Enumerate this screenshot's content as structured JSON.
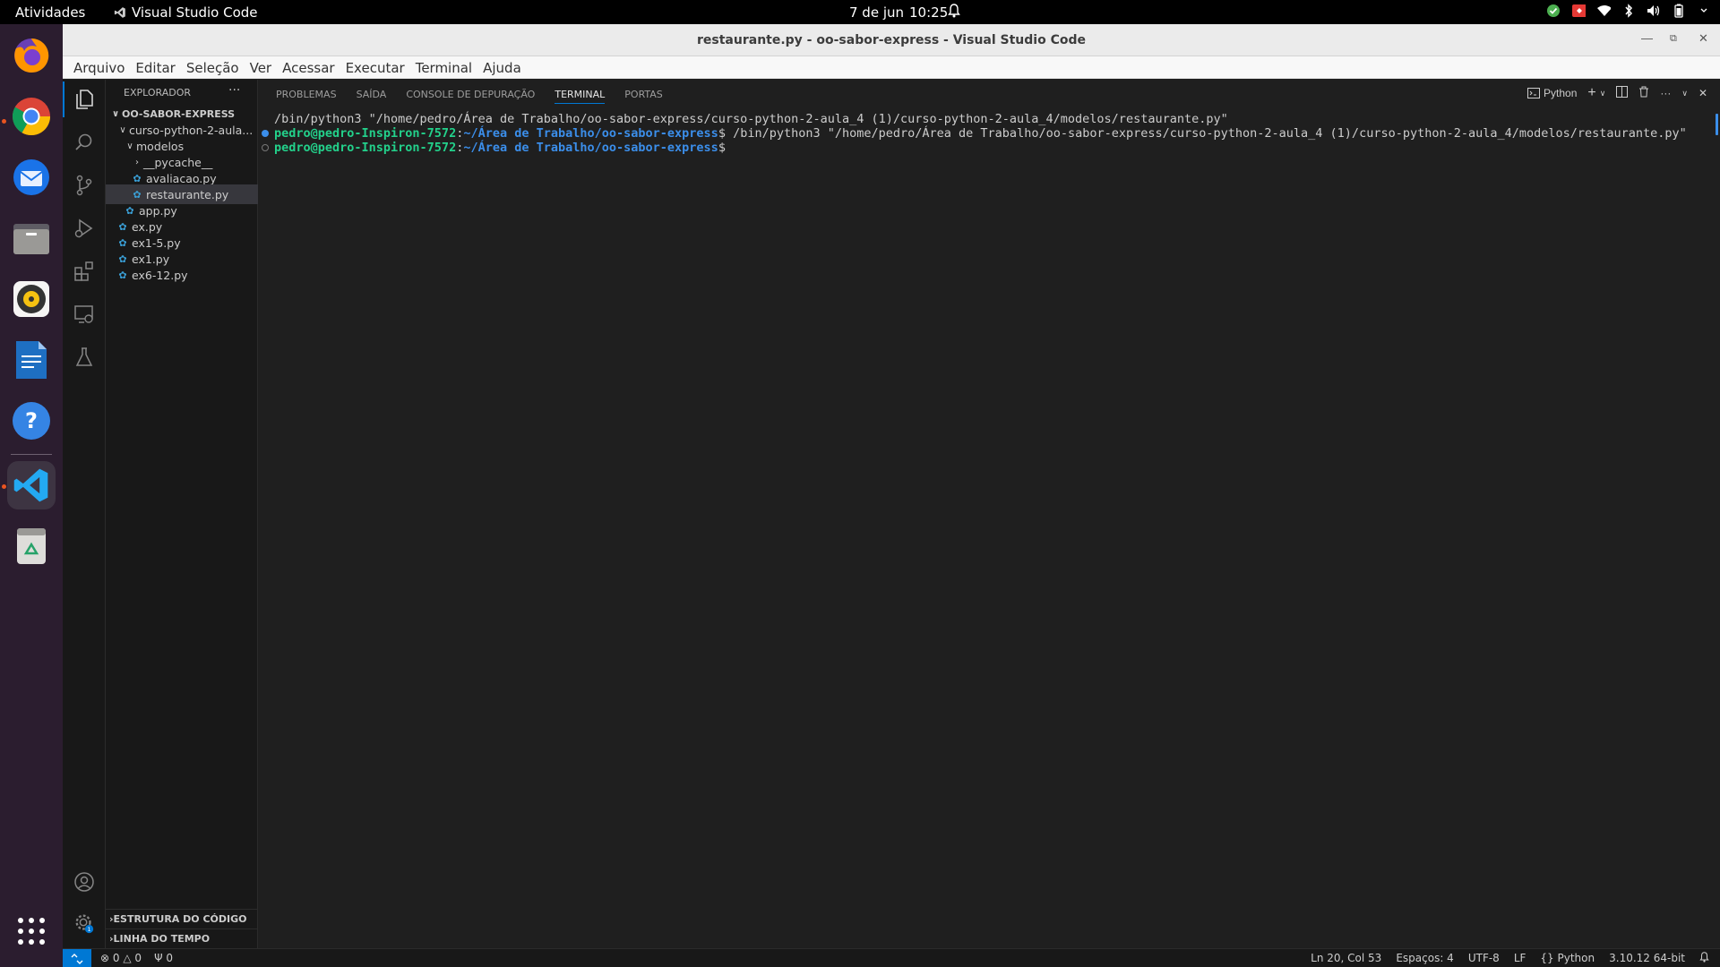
{
  "topbar": {
    "activities": "Atividades",
    "app_name": "Visual Studio Code",
    "date": "7 de jun",
    "time": "10:25"
  },
  "window": {
    "title": "restaurante.py - oo-sabor-express - Visual Studio Code"
  },
  "menu": [
    "Arquivo",
    "Editar",
    "Seleção",
    "Ver",
    "Acessar",
    "Executar",
    "Terminal",
    "Ajuda"
  ],
  "explorer": {
    "header": "EXPLORADOR",
    "root": "OO-SABOR-EXPRESS",
    "tree": [
      {
        "label": "curso-python-2-aula...",
        "kind": "folder"
      },
      {
        "label": "modelos",
        "kind": "folder"
      },
      {
        "label": "__pycache__",
        "kind": "folder-collapsed"
      },
      {
        "label": "avaliacao.py",
        "kind": "file"
      },
      {
        "label": "restaurante.py",
        "kind": "file",
        "selected": true
      },
      {
        "label": "app.py",
        "kind": "file"
      },
      {
        "label": "ex.py",
        "kind": "file"
      },
      {
        "label": "ex1-5.py",
        "kind": "file"
      },
      {
        "label": "ex1.py",
        "kind": "file"
      },
      {
        "label": "ex6-12.py",
        "kind": "file"
      }
    ],
    "outline": "ESTRUTURA DO CÓDIGO",
    "timeline": "LINHA DO TEMPO"
  },
  "panel": {
    "tabs": [
      "PROBLEMAS",
      "SAÍDA",
      "CONSOLE DE DEPURAÇÃO",
      "TERMINAL",
      "PORTAS"
    ],
    "active_tab": "TERMINAL",
    "terminal_profile": "Python"
  },
  "terminal": {
    "line1": "/bin/python3 \"/home/pedro/Área de Trabalho/oo-sabor-express/curso-python-2-aula_4 (1)/curso-python-2-aula_4/modelos/restaurante.py\"",
    "user": "pedro@pedro-Inspiron-7572",
    "path": "~/Área de Trabalho/oo-sabor-express",
    "command": "$ /bin/python3 \"/home/pedro/Área de Trabalho/oo-sabor-express/curso-python-2-aula_4 (1)/curso-python-2-aula_4/modelos/restaurante.py\"",
    "prompt_end": "$"
  },
  "statusbar": {
    "errors": "0",
    "warnings": "0",
    "ports": "0",
    "position": "Ln 20, Col 53",
    "spaces": "Espaços: 4",
    "encoding": "UTF-8",
    "eol": "LF",
    "language": "Python",
    "interpreter": "3.10.12 64-bit"
  },
  "colors": {
    "accent": "#0078d4",
    "terminal_user": "#23d18b",
    "terminal_path": "#3b8eea"
  }
}
